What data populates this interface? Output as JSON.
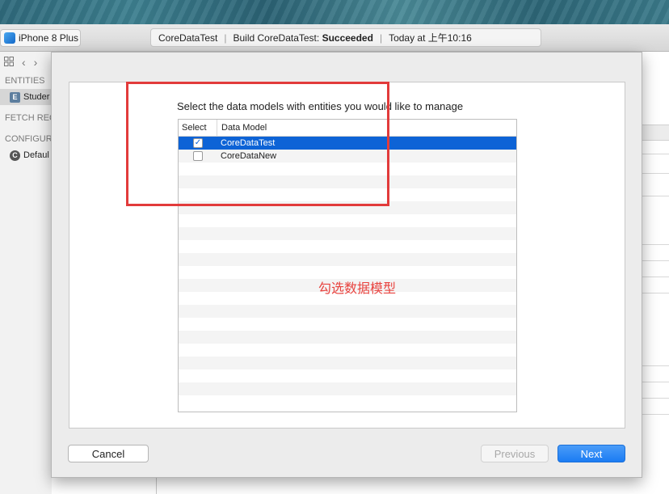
{
  "toolbar": {
    "scheme_device": "iPhone 8 Plus",
    "activity_project": "CoreDataTest",
    "activity_build_prefix": "Build CoreDataTest:",
    "activity_build_status": "Succeeded",
    "activity_time": "Today at 上午10:16"
  },
  "navigator": {
    "entities_header": "ENTITIES",
    "entity_item": "Studer",
    "fetch_header": "FETCH REQ",
    "config_header": "CONFIGUR",
    "config_item": "Defaul",
    "entity_badge": "E",
    "config_badge": "C"
  },
  "sheet": {
    "instruction": "Select the data models with entities you would like to manage",
    "columns": {
      "select": "Select",
      "model": "Data Model"
    },
    "models": [
      {
        "name": "CoreDataTest",
        "checked": true,
        "selected": true
      },
      {
        "name": "CoreDataNew",
        "checked": false,
        "selected": false
      }
    ],
    "annotation": "勾选数据模型",
    "cancel_label": "Cancel",
    "previous_label": "Previous",
    "next_label": "Next"
  },
  "colors": {
    "selection": "#0d63d6",
    "annotation": "#e23b3b",
    "primary_button": "#1b7cf3"
  },
  "icons": {
    "check": "✓",
    "nav_grid": "grid-icon",
    "nav_back": "‹",
    "nav_forward": "›"
  }
}
